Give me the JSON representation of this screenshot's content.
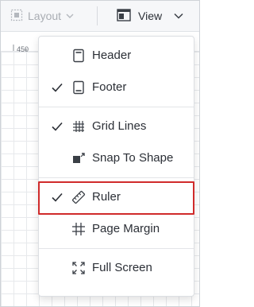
{
  "toolbar": {
    "layout_label": "Layout",
    "layout_icon": "layout-select-icon",
    "view_label": "View",
    "view_icon": "view-panel-icon"
  },
  "ruler": {
    "label": "450"
  },
  "menu": {
    "items": [
      {
        "label": "Header",
        "checked": false,
        "icon": "header-icon"
      },
      {
        "label": "Footer",
        "checked": true,
        "icon": "footer-icon"
      },
      {
        "label": "Grid Lines",
        "checked": true,
        "icon": "grid-lines-icon"
      },
      {
        "label": "Snap To Shape",
        "checked": false,
        "icon": "snap-to-shape-icon"
      },
      {
        "label": "Ruler",
        "checked": true,
        "icon": "ruler-icon",
        "highlighted": true
      },
      {
        "label": "Page Margin",
        "checked": false,
        "icon": "page-margin-icon"
      },
      {
        "label": "Full Screen",
        "checked": false,
        "icon": "full-screen-icon"
      }
    ]
  },
  "colors": {
    "highlight_border": "#d02b2b",
    "text": "#2b2f36",
    "disabled_text": "#a9adb3"
  }
}
